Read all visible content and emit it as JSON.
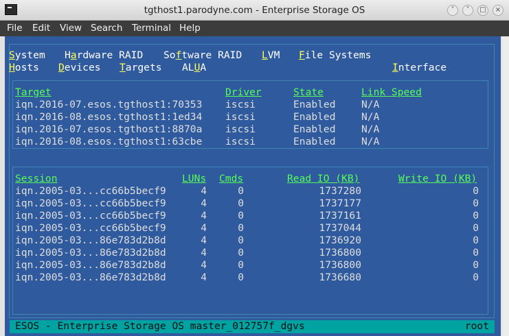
{
  "window": {
    "title": "tgthost1.parodyne.com - Enterprise Storage OS",
    "menu": [
      "File",
      "Edit",
      "View",
      "Search",
      "Terminal",
      "Help"
    ]
  },
  "nav": {
    "system": {
      "hot": "S",
      "rest": "ystem"
    },
    "hardware_raid": {
      "pre": "H",
      "hot": "a",
      "rest": "rdware RAID"
    },
    "software_raid": {
      "pre": "So",
      "hot": "f",
      "rest": "tware RAID"
    },
    "lvm": {
      "hot": "L",
      "rest": "VM"
    },
    "file_systems": {
      "hot": "F",
      "rest": "ile Systems"
    },
    "hosts": {
      "hot": "H",
      "rest": "osts"
    },
    "devices": {
      "hot": "D",
      "rest": "evices"
    },
    "targets": {
      "hot": "T",
      "rest": "argets"
    },
    "alua": {
      "pre": "AL",
      "hot": "U",
      "rest": "A"
    },
    "interface": {
      "hot": "I",
      "rest": "nterface"
    }
  },
  "targets_table": {
    "headers": {
      "target": "Target",
      "driver": "Driver",
      "state": "State",
      "link_speed": "Link Speed"
    },
    "rows": [
      {
        "target": "iqn.2016-07.esos.tgthost1:70353",
        "driver": "iscsi",
        "state": "Enabled",
        "link_speed": "N/A"
      },
      {
        "target": "iqn.2016-08.esos.tgthost1:1ed34",
        "driver": "iscsi",
        "state": "Enabled",
        "link_speed": "N/A"
      },
      {
        "target": "iqn.2016-07.esos.tgthost1:8870a",
        "driver": "iscsi",
        "state": "Enabled",
        "link_speed": "N/A"
      },
      {
        "target": "iqn.2016-08.esos.tgthost1:63cbe",
        "driver": "iscsi",
        "state": "Enabled",
        "link_speed": "N/A"
      }
    ]
  },
  "sessions_table": {
    "headers": {
      "session": "Session",
      "luns": "LUNs",
      "cmds": "Cmds",
      "read_io": "Read IO (KB)",
      "write_io": "Write IO (KB)"
    },
    "rows": [
      {
        "session": "iqn.2005-03...cc66b5becf9",
        "luns": "4",
        "cmds": "0",
        "read_io": "1737280",
        "write_io": "0"
      },
      {
        "session": "iqn.2005-03...cc66b5becf9",
        "luns": "4",
        "cmds": "0",
        "read_io": "1737177",
        "write_io": "0"
      },
      {
        "session": "iqn.2005-03...cc66b5becf9",
        "luns": "4",
        "cmds": "0",
        "read_io": "1737161",
        "write_io": "0"
      },
      {
        "session": "iqn.2005-03...cc66b5becf9",
        "luns": "4",
        "cmds": "0",
        "read_io": "1737044",
        "write_io": "0"
      },
      {
        "session": "iqn.2005-03...86e783d2b8d",
        "luns": "4",
        "cmds": "0",
        "read_io": "1736920",
        "write_io": "0"
      },
      {
        "session": "iqn.2005-03...86e783d2b8d",
        "luns": "4",
        "cmds": "0",
        "read_io": "1736800",
        "write_io": "0"
      },
      {
        "session": "iqn.2005-03...86e783d2b8d",
        "luns": "4",
        "cmds": "0",
        "read_io": "1736800",
        "write_io": "0"
      },
      {
        "session": "iqn.2005-03...86e783d2b8d",
        "luns": "4",
        "cmds": "0",
        "read_io": "1736680",
        "write_io": "0"
      }
    ]
  },
  "status_bar": {
    "left": "ESOS - Enterprise Storage OS master_012757f_dgvs",
    "right": "root"
  },
  "colors": {
    "screen_bg": "#2f5a9e",
    "hotkey": "#ffff54",
    "header": "#55ff55",
    "status_bg": "#00a2a2",
    "box_border": "#3f86b3"
  },
  "icons": [
    "terminal-app-icon",
    "chevron-up-icon",
    "chevron-down-icon",
    "minimize-icon",
    "close-icon"
  ]
}
